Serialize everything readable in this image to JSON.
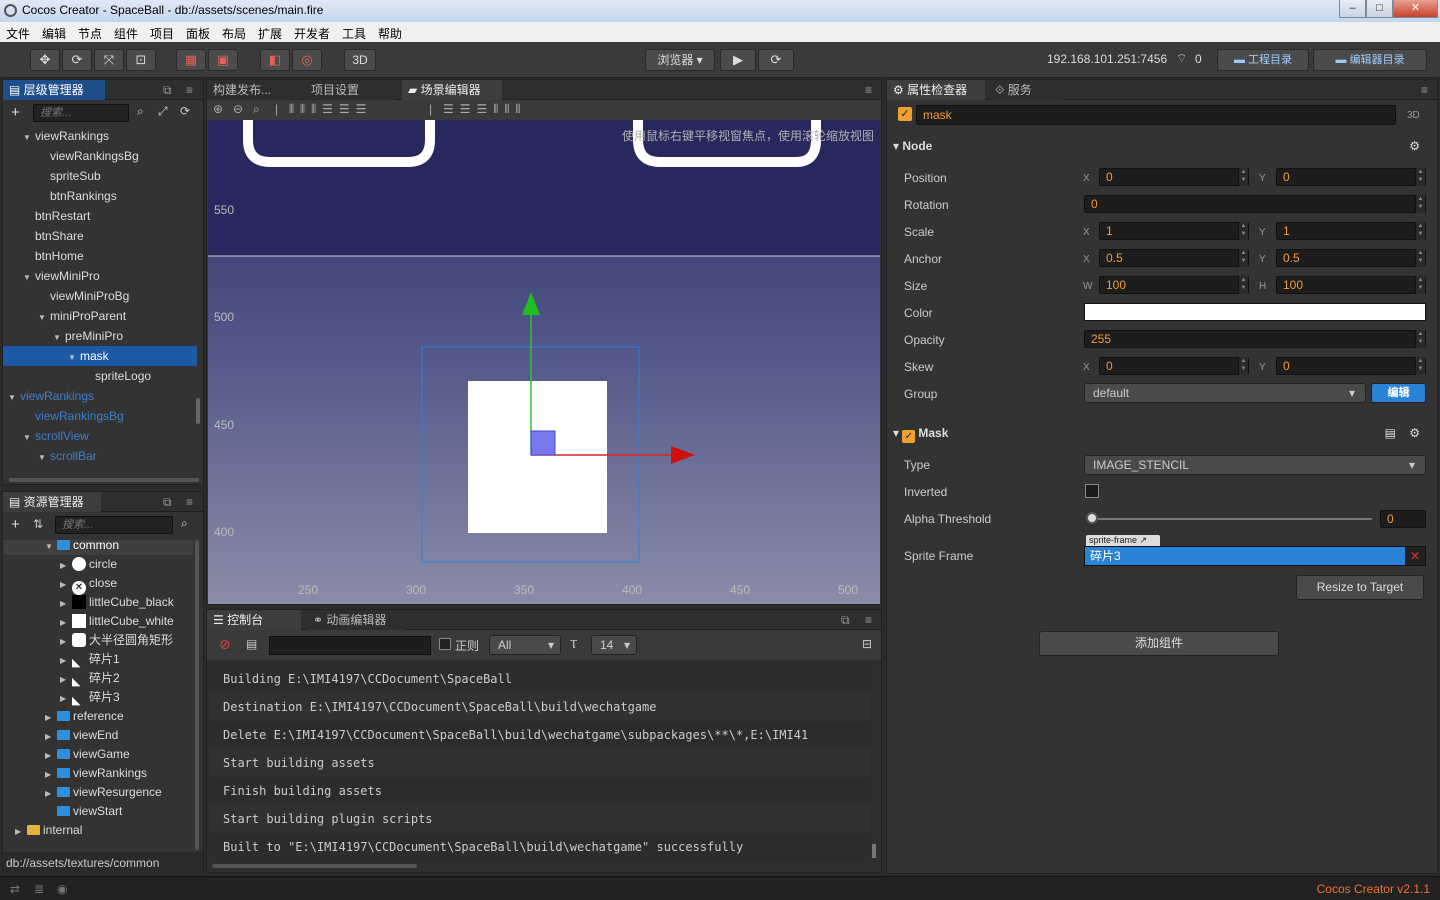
{
  "window": {
    "title": "Cocos Creator - SpaceBall - db://assets/scenes/main.fire",
    "min": "–",
    "max": "□",
    "close": "✕"
  },
  "menu": [
    "文件",
    "编辑",
    "节点",
    "组件",
    "项目",
    "面板",
    "布局",
    "扩展",
    "开发者",
    "工具",
    "帮助"
  ],
  "toolbar": {
    "mode3d": "3D",
    "browser": "浏览器",
    "ip": "192.168.101.251:7456",
    "wifi_count": "0",
    "project_dir": "工程目录",
    "editor_dir": "编辑器目录"
  },
  "hierarchy": {
    "title": "层级管理器",
    "search_placeholder": "搜索...",
    "items": [
      {
        "label": "viewRankings",
        "indent": 4,
        "arrow": "▼"
      },
      {
        "label": "viewRankingsBg",
        "indent": 5,
        "arrow": ""
      },
      {
        "label": "spriteSub",
        "indent": 5,
        "arrow": ""
      },
      {
        "label": "btnRankings",
        "indent": 5,
        "arrow": ""
      },
      {
        "label": "btnRestart",
        "indent": 4,
        "arrow": ""
      },
      {
        "label": "btnShare",
        "indent": 4,
        "arrow": ""
      },
      {
        "label": "btnHome",
        "indent": 4,
        "arrow": ""
      },
      {
        "label": "viewMiniPro",
        "indent": 4,
        "arrow": "▼"
      },
      {
        "label": "viewMiniProBg",
        "indent": 5,
        "arrow": ""
      },
      {
        "label": "miniProParent",
        "indent": 5,
        "arrow": "▼"
      },
      {
        "label": "preMiniPro",
        "indent": 6,
        "arrow": "▼"
      },
      {
        "label": "mask",
        "indent": 7,
        "arrow": "▼",
        "selected": true
      },
      {
        "label": "spriteLogo",
        "indent": 8,
        "arrow": ""
      },
      {
        "label": "viewRankings",
        "indent": 3,
        "arrow": "▼",
        "dim": true
      },
      {
        "label": "viewRankingsBg",
        "indent": 4,
        "arrow": "",
        "dim": true
      },
      {
        "label": "scrollView",
        "indent": 4,
        "arrow": "▼",
        "dim": true
      },
      {
        "label": "scrollBar",
        "indent": 5,
        "arrow": "▼",
        "dim": true
      }
    ]
  },
  "assets": {
    "title": "资源管理器",
    "search_placeholder": "搜索...",
    "items": [
      {
        "label": "common",
        "indent": 2,
        "arrow": "▼",
        "kind": "folder",
        "selected": true
      },
      {
        "label": "circle",
        "indent": 3,
        "arrow": "▶",
        "kind": "circle"
      },
      {
        "label": "close",
        "indent": 3,
        "arrow": "▶",
        "kind": "close"
      },
      {
        "label": "littleCube_black",
        "indent": 3,
        "arrow": "▶",
        "kind": "black"
      },
      {
        "label": "littleCube_white",
        "indent": 3,
        "arrow": "▶",
        "kind": "white"
      },
      {
        "label": "大半径圆角矩形",
        "indent": 3,
        "arrow": "▶",
        "kind": "roundrect"
      },
      {
        "label": "碎片1",
        "indent": 3,
        "arrow": "▶",
        "kind": "shard"
      },
      {
        "label": "碎片2",
        "indent": 3,
        "arrow": "▶",
        "kind": "shard"
      },
      {
        "label": "碎片3",
        "indent": 3,
        "arrow": "▶",
        "kind": "shard"
      },
      {
        "label": "reference",
        "indent": 2,
        "arrow": "▶",
        "kind": "folder"
      },
      {
        "label": "viewEnd",
        "indent": 2,
        "arrow": "▶",
        "kind": "folder"
      },
      {
        "label": "viewGame",
        "indent": 2,
        "arrow": "▶",
        "kind": "folder"
      },
      {
        "label": "viewRankings",
        "indent": 2,
        "arrow": "▶",
        "kind": "folder"
      },
      {
        "label": "viewResurgence",
        "indent": 2,
        "arrow": "▶",
        "kind": "folder"
      },
      {
        "label": "viewStart",
        "indent": 2,
        "arrow": "",
        "kind": "folder"
      },
      {
        "label": "internal",
        "indent": 0,
        "arrow": "▶",
        "kind": "lock"
      }
    ],
    "path": "db://assets/textures/common"
  },
  "center_tabs": [
    "构建发布...",
    "项目设置",
    "场景编辑器"
  ],
  "scene": {
    "hint": "使用鼠标右键平移视窗焦点，使用滚轮缩放视图",
    "y_labels": [
      "550",
      "500",
      "450",
      "400"
    ],
    "x_labels": [
      "250",
      "300",
      "350",
      "400",
      "450",
      "500"
    ]
  },
  "console": {
    "tabs": [
      "控制台",
      "动画编辑器"
    ],
    "regex_label": "正则",
    "filter": "All",
    "font_size": "14",
    "lines": [
      "Building E:\\IMI4197\\CCDocument\\SpaceBall",
      "Destination E:\\IMI4197\\CCDocument\\SpaceBall\\build\\wechatgame",
      "Delete E:\\IMI4197\\CCDocument\\SpaceBall\\build\\wechatgame\\subpackages\\**\\*,E:\\IMI41",
      "Start building assets",
      "Finish building assets",
      "Start building plugin scripts",
      "Built to \"E:\\IMI4197\\CCDocument\\SpaceBall\\build\\wechatgame\" successfully"
    ]
  },
  "inspector": {
    "tabs": [
      "属性检查器",
      "服务"
    ],
    "node_name": "mask",
    "tag3d": "3D",
    "node_section": "Node",
    "position": {
      "label": "Position",
      "x": "0",
      "y": "0"
    },
    "rotation": {
      "label": "Rotation",
      "value": "0"
    },
    "scale": {
      "label": "Scale",
      "x": "1",
      "y": "1"
    },
    "anchor": {
      "label": "Anchor",
      "x": "0.5",
      "y": "0.5"
    },
    "size": {
      "label": "Size",
      "w": "100",
      "h": "100"
    },
    "color": {
      "label": "Color",
      "value": "#ffffff"
    },
    "opacity": {
      "label": "Opacity",
      "value": "255"
    },
    "skew": {
      "label": "Skew",
      "x": "0",
      "y": "0"
    },
    "group": {
      "label": "Group",
      "value": "default",
      "edit": "编辑"
    },
    "axis_x": "X",
    "axis_y": "Y",
    "axis_w": "W",
    "axis_h": "H",
    "mask_section": "Mask",
    "type": {
      "label": "Type",
      "value": "IMAGE_STENCIL"
    },
    "inverted": {
      "label": "Inverted"
    },
    "alpha": {
      "label": "Alpha Threshold",
      "value": "0"
    },
    "sprite_frame": {
      "label": "Sprite Frame",
      "tag": "sprite-frame",
      "value": "碎片3"
    },
    "resize_btn": "Resize to Target",
    "add_component": "添加组件"
  },
  "status": {
    "version": "Cocos Creator v2.1.1"
  },
  "colors": {
    "accent": "#1c5aa5",
    "number": "#f09a3a",
    "version": "#f0732a"
  }
}
